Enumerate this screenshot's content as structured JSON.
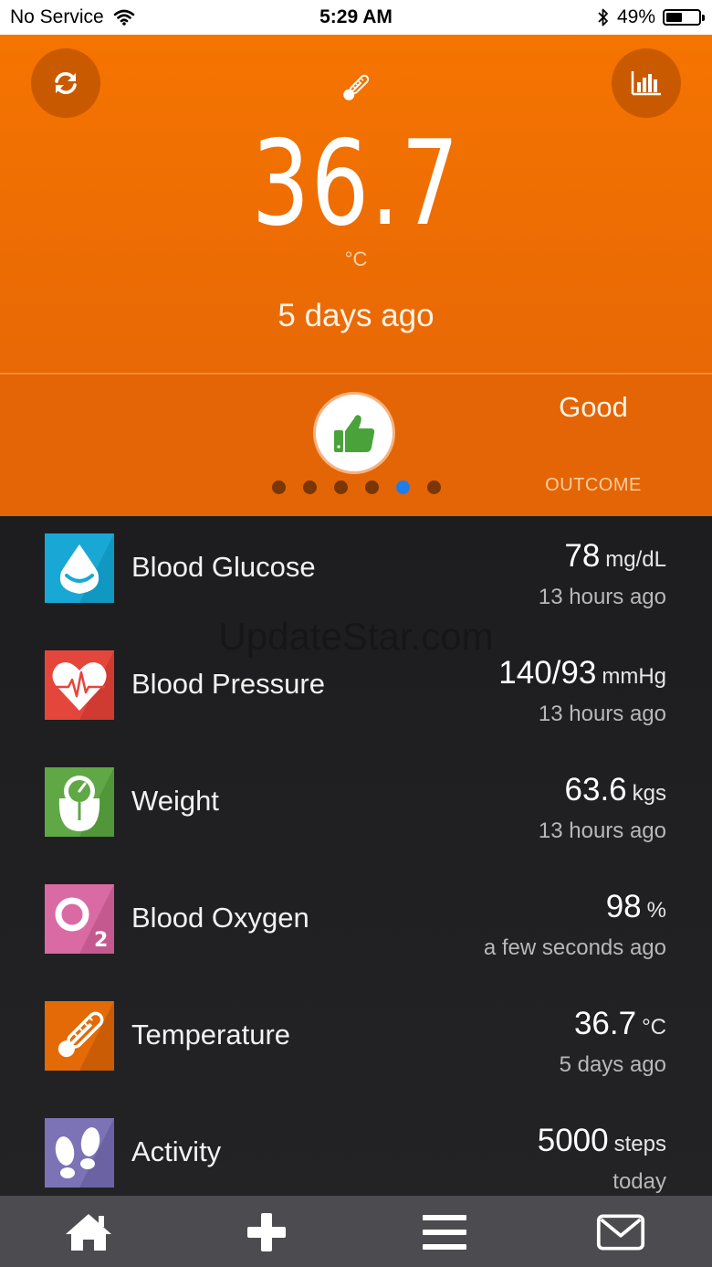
{
  "status_bar": {
    "carrier": "No Service",
    "time": "5:29 AM",
    "battery": "49%",
    "battery_level": 0.49
  },
  "header": {
    "value": "36.7",
    "unit": "°C",
    "time_ago": "5 days ago",
    "outcome_value": "Good",
    "outcome_label": "OUTCOME",
    "page_count": 6,
    "active_page": 5
  },
  "watermark": "UpdateStar.com",
  "list": [
    {
      "name": "Blood Glucose",
      "value": "78",
      "unit": "mg/dL",
      "time": "13 hours ago",
      "icon": "blood-glucose-icon",
      "color": "#19a8d6"
    },
    {
      "name": "Blood Pressure",
      "value": "140/93",
      "unit": "mmHg",
      "time": "13 hours ago",
      "icon": "blood-pressure-icon",
      "color": "#e5463c"
    },
    {
      "name": "Weight",
      "value": "63.6",
      "unit": "kgs",
      "time": "13 hours ago",
      "icon": "weight-icon",
      "color": "#5fa845"
    },
    {
      "name": "Blood Oxygen",
      "value": "98",
      "unit": "%",
      "time": "a few seconds ago",
      "icon": "blood-oxygen-icon",
      "color": "#d96aa4"
    },
    {
      "name": "Temperature",
      "value": "36.7",
      "unit": "°C",
      "time": "5 days ago",
      "icon": "temperature-icon",
      "color": "#e36a06"
    },
    {
      "name": "Activity",
      "value": "5000",
      "unit": "steps",
      "time": "today",
      "icon": "activity-icon",
      "color": "#7b73b5"
    }
  ],
  "tabbar": {
    "items": [
      {
        "icon": "home-icon"
      },
      {
        "icon": "plus-icon"
      },
      {
        "icon": "menu-icon"
      },
      {
        "icon": "mail-icon"
      }
    ]
  }
}
